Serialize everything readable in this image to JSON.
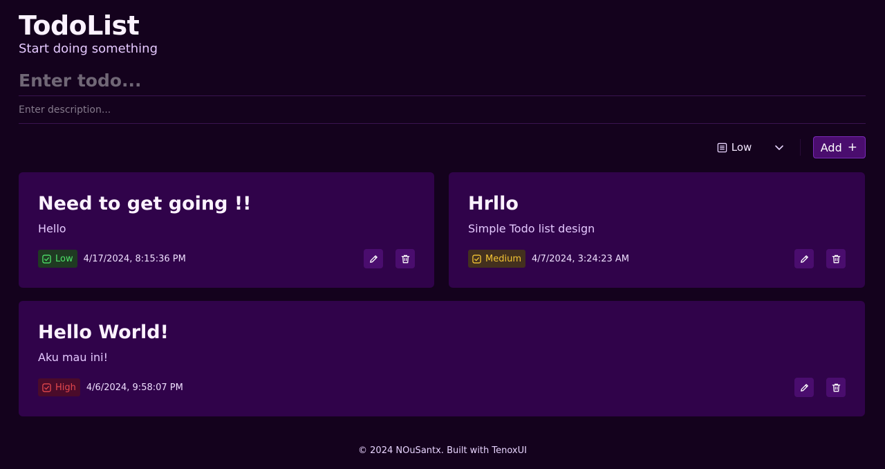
{
  "app": {
    "title": "TodoList",
    "subtitle": "Start doing something"
  },
  "form": {
    "todo_placeholder": "Enter todo...",
    "todo_value": "",
    "description_placeholder": "Enter description...",
    "description_value": "",
    "priority_selected": "Low",
    "priority_icon": "list-icon",
    "add_label": "Add",
    "add_icon": "plus-icon"
  },
  "todos": [
    {
      "title": "Need to get going !!",
      "description": "Hello",
      "priority": "Low",
      "timestamp": "4/17/2024, 8:15:36 PM"
    },
    {
      "title": "Hrllo",
      "description": "Simple Todo list design",
      "priority": "Medium",
      "timestamp": "4/7/2024, 3:24:23 AM"
    },
    {
      "title": "Hello World!",
      "description": "Aku mau ini!",
      "priority": "High",
      "timestamp": "4/6/2024, 9:58:07 PM"
    }
  ],
  "footer": {
    "text": "© 2024 NOuSantx. Built with TenoxUI"
  },
  "colors": {
    "background": "#14021d",
    "card": "#30034a",
    "button": "#4a0d6e",
    "priority_low": "#4ee26a",
    "priority_medium": "#f5c535",
    "priority_high": "#e5484d"
  }
}
